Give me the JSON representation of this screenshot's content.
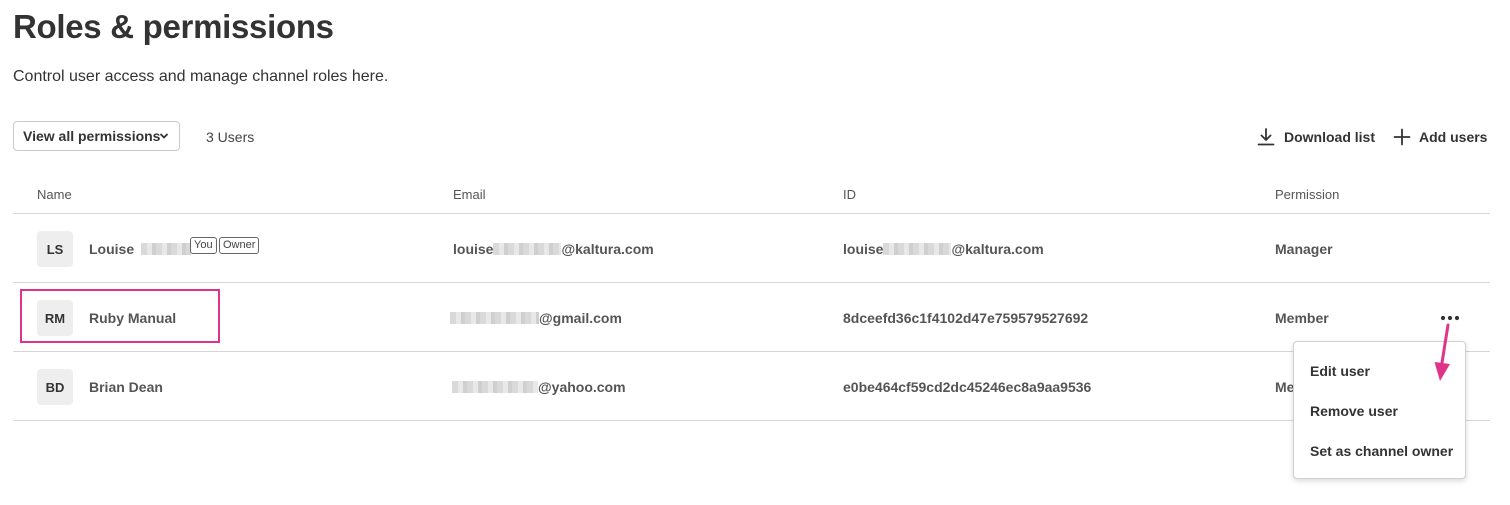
{
  "page": {
    "title": "Roles & permissions",
    "subtitle": "Control user access and manage channel roles here."
  },
  "toolbar": {
    "filter_label": "View all permissions",
    "user_count": "3 Users",
    "download_label": "Download list",
    "add_users_label": "Add users"
  },
  "table": {
    "headers": {
      "name": "Name",
      "email": "Email",
      "id": "ID",
      "permission": "Permission"
    },
    "rows": [
      {
        "initials": "LS",
        "name": "Louise",
        "badges": [
          "You",
          "Owner"
        ],
        "email_prefix": "louise",
        "email_suffix": "@kaltura.com",
        "id_prefix": "louise",
        "id_suffix": "@kaltura.com",
        "permission": "Manager"
      },
      {
        "initials": "RM",
        "name": "Ruby Manual",
        "email_suffix": "@gmail.com",
        "id": "8dceefd36c1f4102d47e759579527692",
        "permission": "Member"
      },
      {
        "initials": "BD",
        "name": "Brian Dean",
        "email_suffix": "@yahoo.com",
        "id": "e0be464cf59cd2dc45246ec8a9aa9536",
        "permission": "Me"
      }
    ]
  },
  "row_menu": {
    "items": [
      "Edit user",
      "Remove user",
      "Set as channel owner"
    ]
  },
  "colors": {
    "highlight": "#e0338a",
    "border": "#d6d6d6",
    "text": "#333333"
  }
}
